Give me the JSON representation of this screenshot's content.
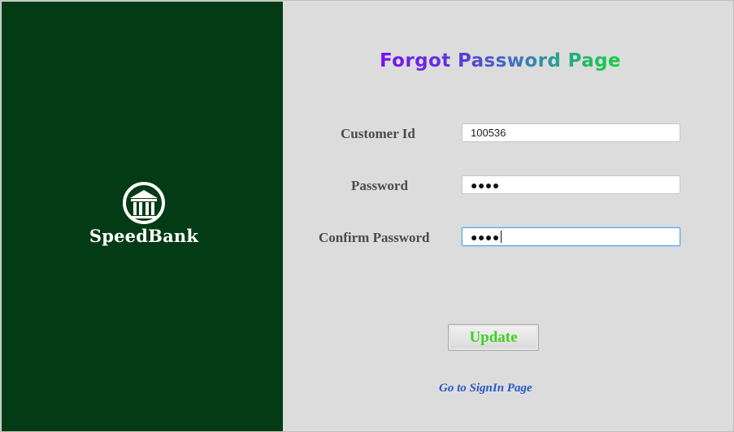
{
  "brand": {
    "name": "SpeedBank",
    "icon": "bank-building-icon",
    "panel_color": "#033b15"
  },
  "form": {
    "title": "Forgot Password Page",
    "title_gradient": [
      "#7a10f2",
      "#3f6fc2",
      "#14d23f"
    ],
    "customer_id": {
      "label": "Customer Id",
      "value": "100536"
    },
    "password": {
      "label": "Password",
      "masked_value": "●●●●"
    },
    "confirm_password": {
      "label": "Confirm Password",
      "masked_value": "●●●●",
      "focused": true
    },
    "update_label": "Update",
    "signin_link": "Go to SignIn Page"
  },
  "colors": {
    "background": "#dcdcdc",
    "update_text": "#3fd21e",
    "link": "#2a55c9",
    "focus_border": "#5aa8df"
  }
}
